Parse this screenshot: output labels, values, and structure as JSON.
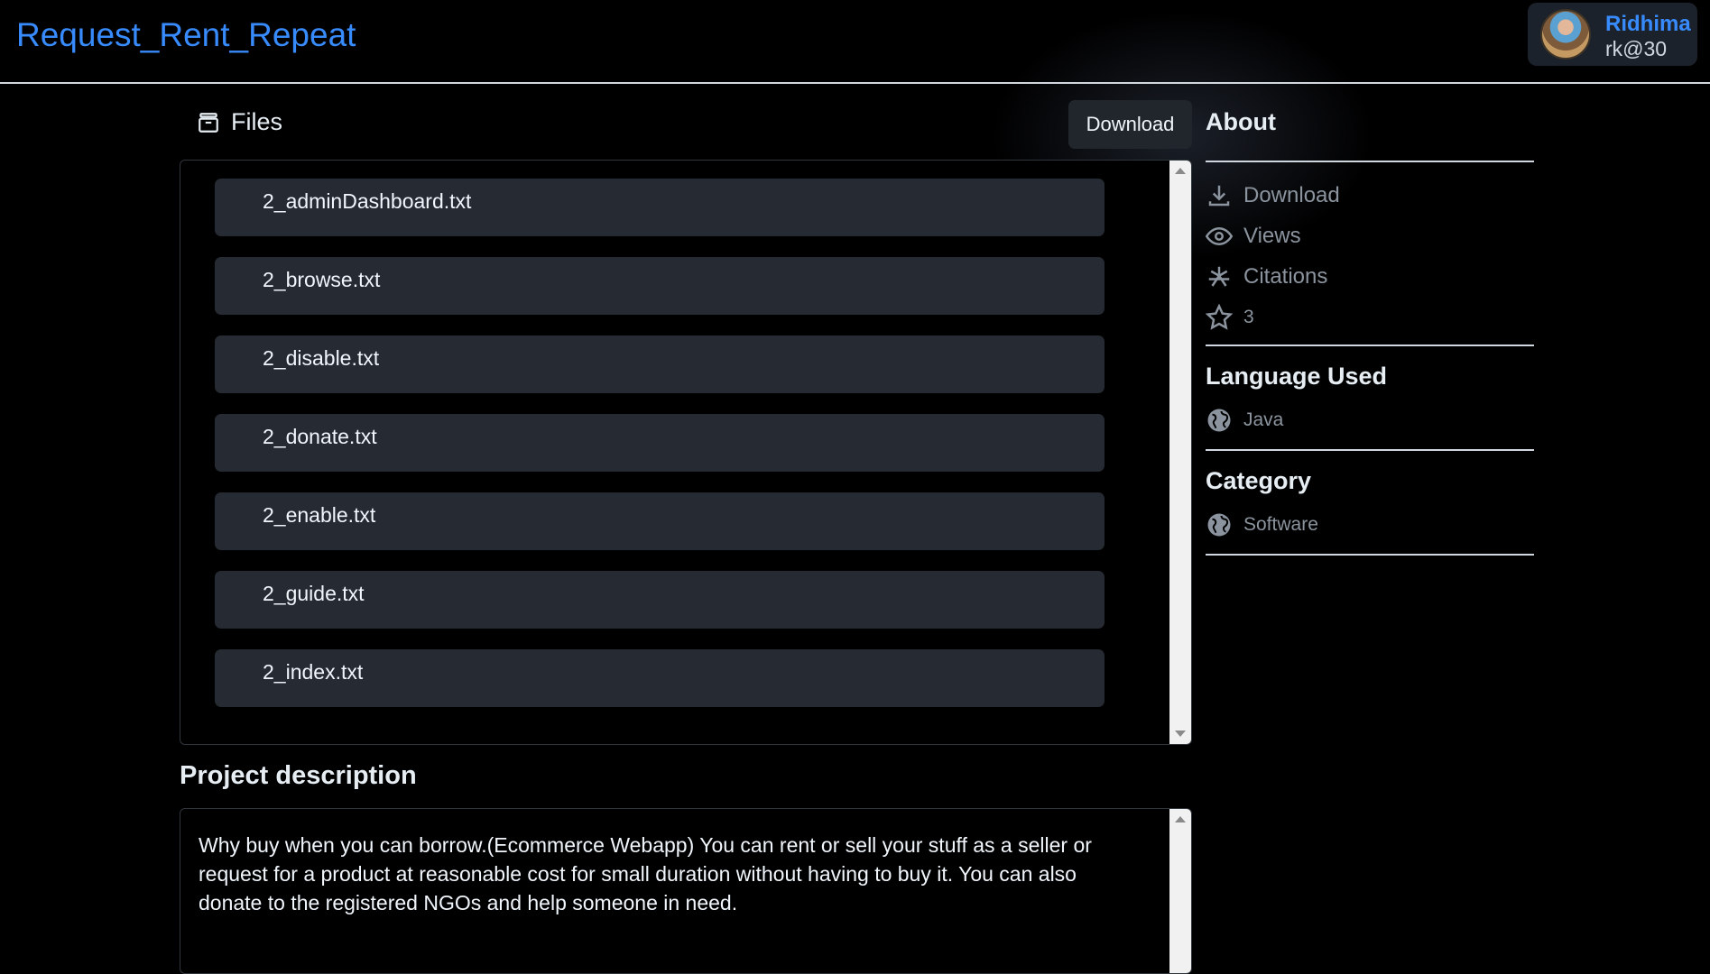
{
  "header": {
    "title": "Request_Rent_Repeat",
    "user_name": "Ridhima",
    "user_handle": "rk@30"
  },
  "files": {
    "title": "Files",
    "download_label": "Download",
    "items": [
      "2_adminDashboard.txt",
      "2_browse.txt",
      "2_disable.txt",
      "2_donate.txt",
      "2_enable.txt",
      "2_guide.txt",
      "2_index.txt"
    ]
  },
  "description": {
    "title": "Project description",
    "text": "Why buy when you can borrow.(Ecommerce Webapp) You can rent or sell your stuff as a seller or request for a product at reasonable cost for small duration without having to buy it. You can also donate to the registered NGOs and help someone in need."
  },
  "sidebar": {
    "about_title": "About",
    "download_label": "Download",
    "views_label": "Views",
    "citations_label": "Citations",
    "stars_count": "3",
    "language_title": "Language Used",
    "language": "Java",
    "category_title": "Category",
    "category": "Software"
  },
  "colors": {
    "accent": "#388bfd",
    "background": "#000000",
    "row_bg": "#262b33",
    "muted": "#8b949e"
  }
}
